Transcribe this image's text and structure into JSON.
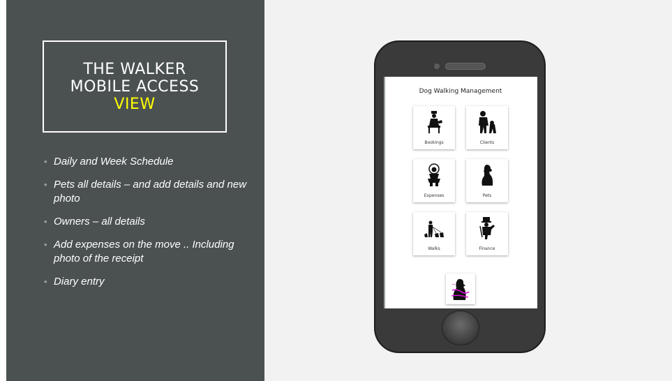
{
  "slide": {
    "title": {
      "line1": "THE WALKER",
      "line2": "MOBILE ACCESS",
      "line3": "VIEW"
    },
    "bullets": [
      {
        "text": "Daily and Week Schedule"
      },
      {
        "text": "Pets all details – and add details and new photo"
      },
      {
        "text": "Owners – all details"
      },
      {
        "text": "Add expenses on the move .. Including photo of the receipt"
      },
      {
        "text": "Diary entry"
      }
    ],
    "bullet_symbol": "•"
  },
  "app": {
    "title": "Dog Walking Management",
    "tiles": [
      {
        "label": "Bookings",
        "icon": "person-with-dog-icon"
      },
      {
        "label": "Clients",
        "icon": "dog-owner-icon"
      },
      {
        "label": "Expenses",
        "icon": "clown-icon"
      },
      {
        "label": "Pets",
        "icon": "dog-icon"
      },
      {
        "label": "Walks",
        "icon": "dog-walker-icon"
      },
      {
        "label": "Finance",
        "icon": "monopoly-man-icon"
      }
    ],
    "logo_icon": "dog-logo-icon"
  },
  "colors": {
    "panel": "#4b5151",
    "accent": "#ffff00",
    "phone_body": "#3a3a3a"
  }
}
